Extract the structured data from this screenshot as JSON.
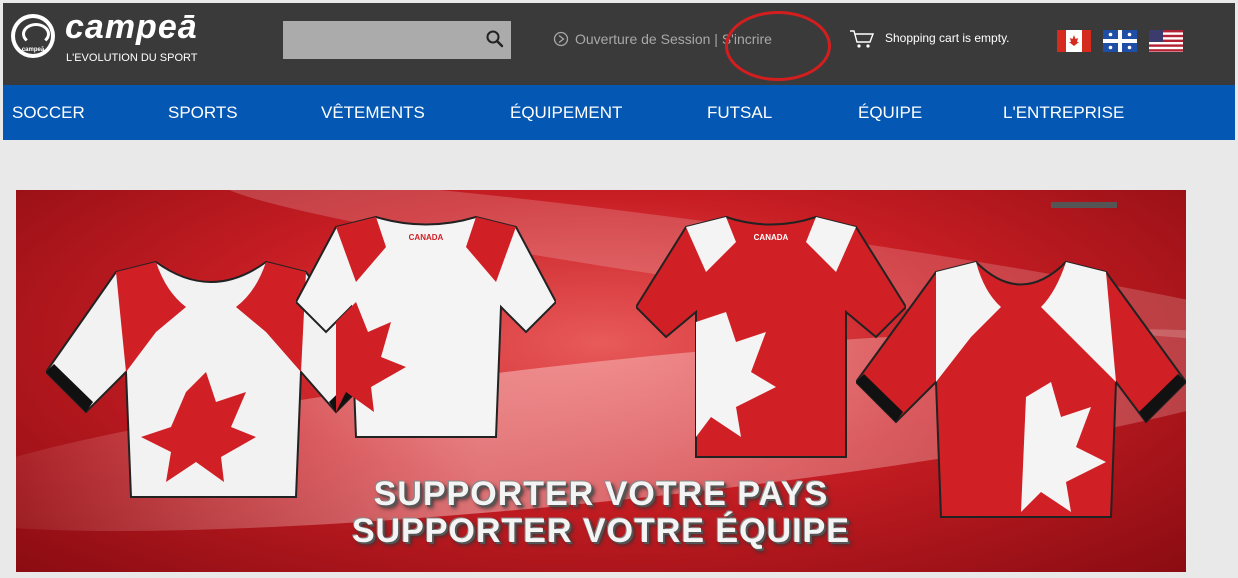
{
  "brand": {
    "logo_small": "campeā",
    "name": "campeā",
    "tagline": "L'EVOLUTION DU SPORT"
  },
  "header": {
    "search": {
      "value": "",
      "placeholder": ""
    },
    "login_text": "Ouverture de Session | S'incrire",
    "cart_text": "Shopping cart is empty.",
    "flags": [
      "canada-flag-icon",
      "quebec-flag-icon",
      "usa-flag-icon"
    ]
  },
  "nav": {
    "items": [
      {
        "label": "SOCCER"
      },
      {
        "label": "SPORTS"
      },
      {
        "label": "VÊTEMENTS"
      },
      {
        "label": "ÉQUIPEMENT"
      },
      {
        "label": "FUTSAL"
      },
      {
        "label": "ÉQUIPE"
      },
      {
        "label": "L'ENTREPRISE"
      }
    ]
  },
  "banner": {
    "line1": "SUPPORTER VOTRE PAYS",
    "line2": "SUPPORTER VOTRE ÉQUIPE",
    "shirt_label": "CANADA"
  },
  "colors": {
    "header_bg": "#3a3a3a",
    "nav_bg": "#0458b4",
    "accent_red": "#d21e1e"
  }
}
